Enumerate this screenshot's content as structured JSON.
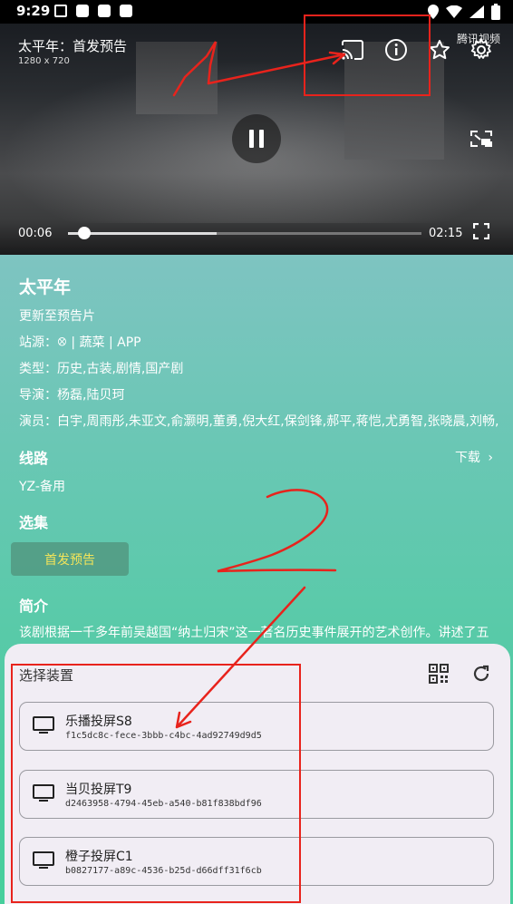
{
  "status_bar": {
    "time": "9:29"
  },
  "player": {
    "title": "太平年：首发预告",
    "resolution": "1280 x 720",
    "brand": "腾讯视频",
    "current_time": "00:06",
    "duration": "02:15",
    "progress": 0.045,
    "buffered": 0.42
  },
  "detail": {
    "title": "太平年",
    "update": "更新至预告片",
    "source": "站源：ꕕ | 蔬菜 | APP",
    "genre": "类型：历史,古装,剧情,国产剧",
    "director": "导演：杨磊,陆贝珂",
    "cast": "演员：白宇,周雨彤,朱亚文,俞灏明,董勇,倪大红,保剑锋,郝平,蒋恺,尤勇智,张晓晨,刘畅,",
    "line_label": "线路",
    "download_label": "下载",
    "line_value": "YZ-备用",
    "episodes_label": "选集",
    "episode_button": "首发预告",
    "intro_label": "简介",
    "intro_text": "该剧根据一千多年前吴越国“纳土归宋”这一著名历史事件展开的艺术创作。讲述了五"
  },
  "sheet": {
    "title": "选择装置",
    "devices": [
      {
        "name": "乐播投屏S8",
        "id": "f1c5dc8c-fece-3bbb-c4bc-4ad92749d9d5"
      },
      {
        "name": "当贝投屏T9",
        "id": "d2463958-4794-45eb-a540-b81f838bdf96"
      },
      {
        "name": "橙子投屏C1",
        "id": "b0827177-a89c-4536-b25d-d66dff31f6cb"
      }
    ]
  },
  "colors": {
    "annotation": "#e8231c",
    "episode_text": "#f2e45a"
  }
}
